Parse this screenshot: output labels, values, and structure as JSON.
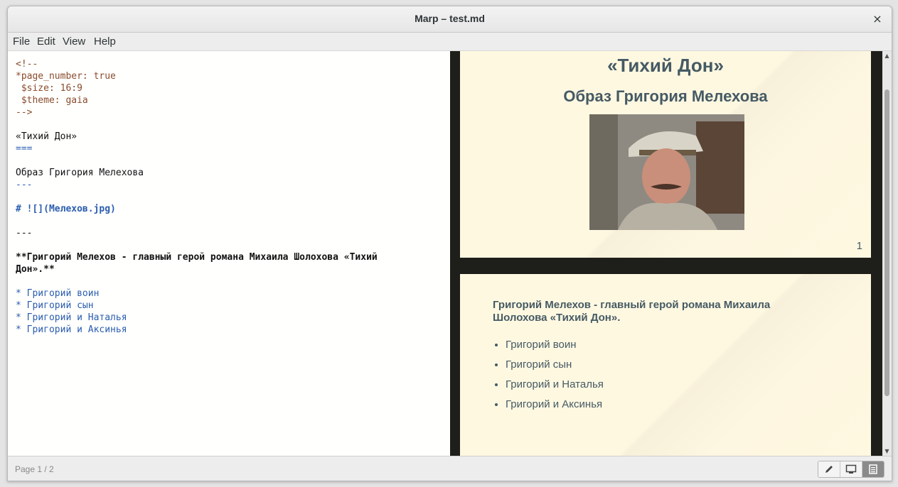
{
  "window": {
    "title": "Marp – test.md",
    "close_glyph": "×"
  },
  "menu": [
    "File",
    "Edit",
    "View",
    "Help"
  ],
  "editor": {
    "lines": [
      "<!--",
      "*page_number: true",
      " $size: 16:9",
      " $theme: gaia",
      "-->",
      "",
      "«Тихий Дон»",
      "===",
      "",
      "Образ Григория Мелехова",
      "---",
      "",
      "# ![](Мелехов.jpg)",
      "",
      "---",
      "",
      "**Григорий Мелехов - главный герой романа Михаила Шолохова «Тихий",
      "Дон».**",
      "",
      "* Григорий воин",
      "* Григорий сын",
      "* Григорий и Наталья",
      "* Григорий и Аксинья"
    ]
  },
  "preview": {
    "slide1": {
      "title": "«Тихий Дон»",
      "subtitle": "Образ Григория Мелехова",
      "image_alt": "Мелехов.jpg",
      "page_number": "1"
    },
    "slide2": {
      "bold_text": "Григорий Мелехов - главный герой романа Михаила Шолохова «Тихий Дон».",
      "items": [
        "Григорий воин",
        "Григорий сын",
        "Григорий и Наталья",
        "Григорий и Аксинья"
      ]
    }
  },
  "status": {
    "page_indicator": "Page 1 / 2",
    "view_buttons": [
      {
        "icon": "pencil-icon",
        "active": false
      },
      {
        "icon": "presentation-icon",
        "active": false
      },
      {
        "icon": "document-icon",
        "active": true
      }
    ]
  },
  "colors": {
    "slide_bg": "#fff8e1",
    "slide_text": "#455a64",
    "preview_bg": "#1e1e1a",
    "comment": "#8a4b2d",
    "markup_blue": "#2a5db0"
  }
}
